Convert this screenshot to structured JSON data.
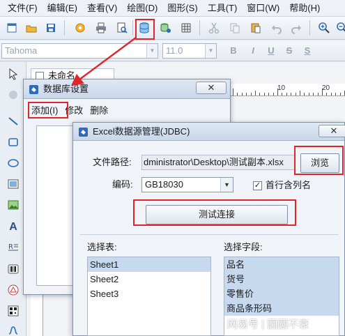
{
  "menubar": {
    "items": [
      "文件(F)",
      "编辑(E)",
      "查看(V)",
      "绘图(D)",
      "图形(S)",
      "工具(T)",
      "窗口(W)",
      "帮助(H)"
    ]
  },
  "toolbar": {
    "icons": [
      "new-icon",
      "open-icon",
      "save-icon",
      "settings-icon",
      "print-icon",
      "print-preview-icon",
      "database-icon",
      "database-link-icon",
      "grid-icon",
      "cut-icon",
      "copy-icon",
      "paste-icon",
      "undo-icon",
      "redo-icon",
      "zoom-in-icon",
      "zoom-out-icon"
    ]
  },
  "format_bar": {
    "font_name": "Tahoma",
    "font_size": "11.0",
    "buttons": [
      "B",
      "I",
      "U",
      "S",
      "S"
    ]
  },
  "document": {
    "tab_title": "未命名"
  },
  "ruler": {
    "labels": [
      "10",
      "20"
    ]
  },
  "db_dialog": {
    "title": "数据库设置",
    "close_label": "✕",
    "menu": [
      "添加(I)",
      "修改",
      "删除"
    ]
  },
  "excel_dialog": {
    "title": "Excel数据源管理(JDBC)",
    "close_label": "✕",
    "file_path_label": "文件路径:",
    "file_path_value": "dministrator\\Desktop\\测试副本.xlsx",
    "browse_label": "浏览",
    "encoding_label": "编码:",
    "encoding_value": "GB18030",
    "first_row_label": "首行含列名",
    "first_row_checked": true,
    "check_mark": "✓",
    "test_label": "测试连接",
    "tables_label": "选择表:",
    "tables": [
      "Sheet1",
      "Sheet2",
      "Sheet3"
    ],
    "fields_label": "选择字段:",
    "fields": [
      "品名",
      "货号",
      "零售价",
      "商品条形码"
    ]
  },
  "watermark": "网易号 | 圆圆不衰",
  "colors": {
    "highlight_red": "#e0262b",
    "selection_blue": "#c7d9ee",
    "title_bar": "#c9d7ea"
  }
}
